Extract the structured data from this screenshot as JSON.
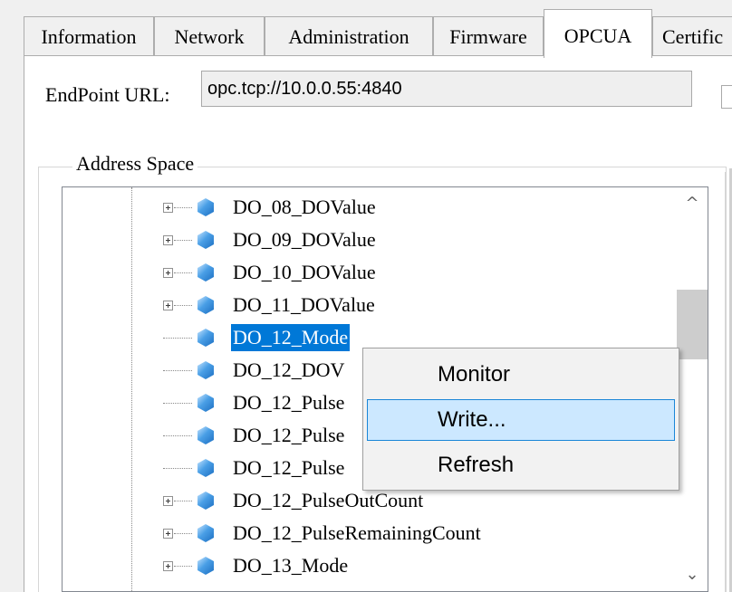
{
  "tabs": [
    {
      "label": "Information",
      "active": false
    },
    {
      "label": "Network",
      "active": false
    },
    {
      "label": "Administration",
      "active": false
    },
    {
      "label": "Firmware",
      "active": false
    },
    {
      "label": "OPCUA",
      "active": true
    },
    {
      "label": "Certific",
      "active": false
    }
  ],
  "endpoint": {
    "label": "EndPoint URL:",
    "value": "opc.tcp://10.0.0.55:4840"
  },
  "address_space": {
    "legend": "Address Space",
    "nodes": [
      {
        "label": "DO_08_DOValue",
        "expandable": true,
        "selected": false
      },
      {
        "label": "DO_09_DOValue",
        "expandable": true,
        "selected": false
      },
      {
        "label": "DO_10_DOValue",
        "expandable": true,
        "selected": false
      },
      {
        "label": "DO_11_DOValue",
        "expandable": true,
        "selected": false
      },
      {
        "label": "DO_12_Mode",
        "expandable": false,
        "selected": true
      },
      {
        "label": "DO_12_DOV",
        "expandable": false,
        "selected": false
      },
      {
        "label": "DO_12_Pulse",
        "expandable": false,
        "selected": false
      },
      {
        "label": "DO_12_Pulse",
        "expandable": false,
        "selected": false
      },
      {
        "label": "DO_12_Pulse",
        "expandable": false,
        "selected": false
      },
      {
        "label": "DO_12_PulseOutCount",
        "expandable": true,
        "selected": false
      },
      {
        "label": "DO_12_PulseRemainingCount",
        "expandable": true,
        "selected": false
      },
      {
        "label": "DO_13_Mode",
        "expandable": true,
        "selected": false
      }
    ]
  },
  "scrollbar": {
    "up_arrow": "^",
    "down_arrow": "⌄"
  },
  "context_menu": {
    "items": [
      {
        "label": "Monitor",
        "highlighted": false
      },
      {
        "label": "Write...",
        "highlighted": true
      },
      {
        "label": "Refresh",
        "highlighted": false
      }
    ]
  },
  "colors": {
    "selection": "#0078d7",
    "menu_highlight": "#cce8ff",
    "menu_highlight_border": "#1a86d8",
    "node_icon": "#2f86d8"
  }
}
